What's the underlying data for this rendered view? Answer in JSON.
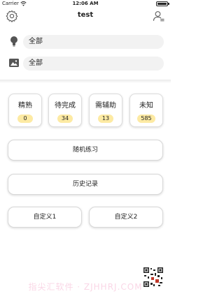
{
  "status_bar": {
    "carrier": "Carrier",
    "time": "12:06 AM"
  },
  "nav": {
    "title": "test",
    "left_icon": "settings-icon",
    "right_icon": "profile-icon"
  },
  "filters": [
    {
      "icon": "lightbulb-icon",
      "value": "全部"
    },
    {
      "icon": "image-icon",
      "value": "全部"
    }
  ],
  "stats": [
    {
      "label": "精熟",
      "count": "0"
    },
    {
      "label": "待完成",
      "count": "34"
    },
    {
      "label": "需辅助",
      "count": "13"
    },
    {
      "label": "未知",
      "count": "585"
    }
  ],
  "buttons": {
    "random_practice": "随机练习",
    "history": "历史记录",
    "custom1": "自定义1",
    "custom2": "自定义2"
  },
  "watermark": "指尖汇软件 · ZJHHRJ.COM",
  "colors": {
    "badge": "#fdeaa3",
    "field_bg": "#f2f2f2",
    "text": "#222222"
  }
}
